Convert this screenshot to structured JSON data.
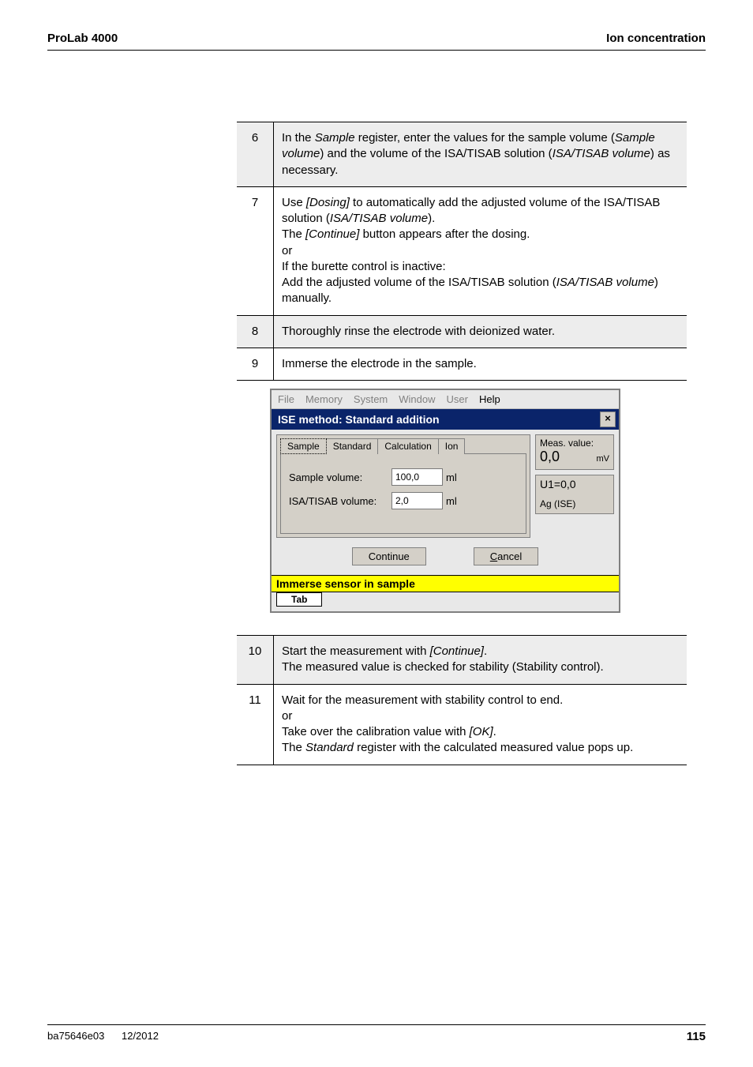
{
  "header": {
    "left": "ProLab 4000",
    "right": "Ion concentration"
  },
  "steps_a": [
    {
      "num": "6",
      "shaded": true,
      "html": "In the <span class=\"italic\">Sample</span> register, enter the values for the sample volume (<span class=\"italic\">Sample volume</span>) and the volume of the ISA/TISAB solution (<span class=\"italic\">ISA/TISAB volume</span>) as necessary."
    },
    {
      "num": "7",
      "shaded": false,
      "html": "Use <span class=\"italic\">[Dosing]</span> to automatically add the adjusted volume of the ISA/TISAB solution (<span class=\"italic\">ISA/TISAB volume</span>).<br>The <span class=\"italic\">[Continue]</span> button appears after the dosing.<br>or<br>If the burette control is inactive:<br>Add the adjusted volume of the ISA/TISAB solution (<span class=\"italic\">ISA/TISAB volume</span>) manually."
    },
    {
      "num": "8",
      "shaded": true,
      "html": "Thoroughly rinse the electrode with deionized water."
    },
    {
      "num": "9",
      "shaded": false,
      "html": "Immerse the electrode in the sample."
    }
  ],
  "dialog": {
    "menu": {
      "file": "File",
      "memory": "Memory",
      "system": "System",
      "window": "Window",
      "user": "User",
      "help": "Help"
    },
    "title": "ISE method:  Standard addition",
    "close": "×",
    "tabs": {
      "sample": "Sample",
      "standard": "Standard",
      "calculation": "Calculation",
      "ion": "Ion"
    },
    "form": {
      "sample_volume_label": "Sample volume:",
      "sample_volume_value": "100,0",
      "isa_volume_label": "ISA/TISAB volume:",
      "isa_volume_value": "2,0",
      "unit": "ml"
    },
    "side": {
      "meas_label": "Meas. value:",
      "meas_value": "0,0",
      "meas_unit": "mV",
      "u1": "U1=0,0",
      "ag": "Ag (ISE)"
    },
    "buttons": {
      "continue": "Continue",
      "cancel": "Cancel"
    },
    "cancel_underline": "C",
    "status": "Immerse sensor in sample",
    "tabkey": "Tab"
  },
  "steps_b": [
    {
      "num": "10",
      "shaded": true,
      "html": "Start the measurement with <span class=\"italic\">[Continue]</span>.<br>The measured value is checked for stability (Stability control)."
    },
    {
      "num": "11",
      "shaded": false,
      "html": "Wait for the measurement with stability control to end.<br>or<br>Take over the calibration value with <span class=\"italic\">[OK]</span>.<br>The <span class=\"italic\">Standard</span> register with the calculated measured value pops up."
    }
  ],
  "footer": {
    "left1": "ba75646e03",
    "left2": "12/2012",
    "right": "115"
  }
}
